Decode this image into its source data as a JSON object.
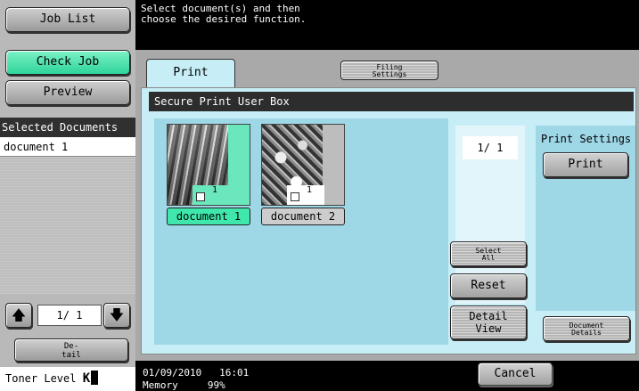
{
  "message": "Select document(s) and then\nchoose the desired function.",
  "left": {
    "job_list": "Job List",
    "check_job": "Check Job",
    "preview": "Preview",
    "selected_documents_header": "Selected Documents",
    "selected_documents": [
      "document 1"
    ],
    "page_counter": "1/ 1",
    "detail_btn": "De-\ntail",
    "toner_label": "Toner Level",
    "toner_color": "K"
  },
  "tabs": {
    "print": "Print",
    "filing_settings": "Filing\nSettings"
  },
  "box_title": "Secure Print User Box",
  "documents": [
    {
      "name": "document 1",
      "count": "1",
      "selected": true
    },
    {
      "name": "document 2",
      "count": "1",
      "selected": false
    }
  ],
  "page_field": "1/ 1",
  "buttons": {
    "select_all": "Select\nAll",
    "reset": "Reset",
    "detail_view": "Detail\nView",
    "print_settings_label": "Print Settings",
    "print": "Print",
    "document_details": "Document\nDetails",
    "cancel": "Cancel"
  },
  "status": {
    "date": "01/09/2010",
    "time": "16:01",
    "memory_label": "Memory",
    "memory_value": "99%"
  },
  "colors": {
    "accent_green": "#3fe7ac",
    "panel_blue": "#c7eef6"
  }
}
